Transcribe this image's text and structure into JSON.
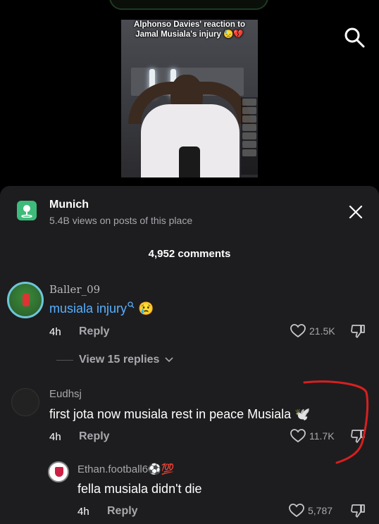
{
  "video": {
    "caption": "Alphonso Davies' reaction to Jamal Musiala's injury 😓💔"
  },
  "place": {
    "name": "Munich",
    "subtitle": "5.4B views on posts of this place"
  },
  "comments_header": "4,952 comments",
  "comments": [
    {
      "username": "Baller_09",
      "text": "musiala injury",
      "text_suffix": "😢",
      "time": "4h",
      "reply_label": "Reply",
      "likes": "21.5K"
    },
    {
      "username": "Eudhsj",
      "text": "first jota now musiala rest in peace Musiala 🕊️",
      "time": "4h",
      "reply_label": "Reply",
      "likes": "11.7K"
    },
    {
      "username": "Ethan.football6⚽💯",
      "text": "fella musiala didn't die",
      "time": "4h",
      "reply_label": "Reply",
      "likes": "5,787"
    }
  ],
  "view_replies": "View 15 replies",
  "colors": {
    "sheet_bg": "#1d1d1f",
    "link_blue": "#57b0ff",
    "place_green": "#3dbb7a",
    "annotation_red": "#d62020"
  },
  "icons": [
    "search-icon",
    "close-icon",
    "location-pin-icon",
    "heart-icon",
    "dislike-icon",
    "chevron-down-icon",
    "search-small-icon"
  ]
}
